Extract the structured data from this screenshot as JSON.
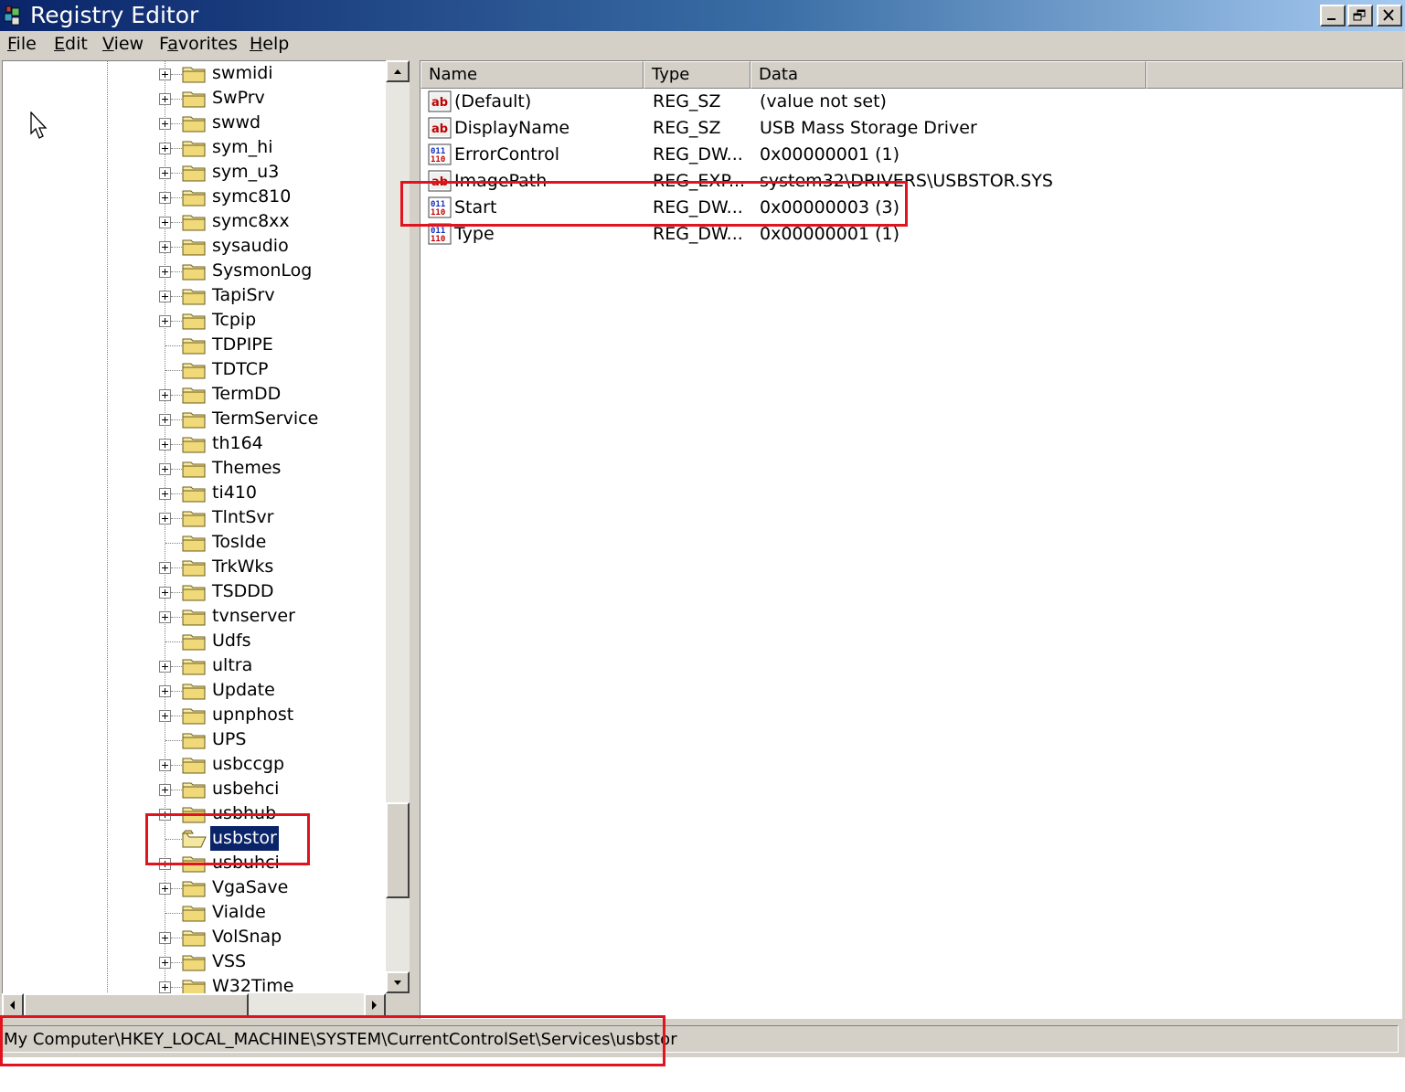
{
  "window": {
    "title": "Registry Editor"
  },
  "menu": [
    {
      "pre": "",
      "key": "F",
      "post": "ile"
    },
    {
      "pre": "",
      "key": "E",
      "post": "dit"
    },
    {
      "pre": "",
      "key": "V",
      "post": "iew"
    },
    {
      "pre": "F",
      "key": "a",
      "post": "vorites"
    },
    {
      "pre": "",
      "key": "H",
      "post": "elp"
    }
  ],
  "tree": {
    "items": [
      {
        "label": "swmidi",
        "expandable": true
      },
      {
        "label": "SwPrv",
        "expandable": true
      },
      {
        "label": "swwd",
        "expandable": true
      },
      {
        "label": "sym_hi",
        "expandable": true
      },
      {
        "label": "sym_u3",
        "expandable": true
      },
      {
        "label": "symc810",
        "expandable": true
      },
      {
        "label": "symc8xx",
        "expandable": true
      },
      {
        "label": "sysaudio",
        "expandable": true
      },
      {
        "label": "SysmonLog",
        "expandable": true
      },
      {
        "label": "TapiSrv",
        "expandable": true
      },
      {
        "label": "Tcpip",
        "expandable": true
      },
      {
        "label": "TDPIPE",
        "expandable": false
      },
      {
        "label": "TDTCP",
        "expandable": false
      },
      {
        "label": "TermDD",
        "expandable": true
      },
      {
        "label": "TermService",
        "expandable": true
      },
      {
        "label": "th164",
        "expandable": true
      },
      {
        "label": "Themes",
        "expandable": true
      },
      {
        "label": "ti410",
        "expandable": true
      },
      {
        "label": "TlntSvr",
        "expandable": true
      },
      {
        "label": "TosIde",
        "expandable": false
      },
      {
        "label": "TrkWks",
        "expandable": true
      },
      {
        "label": "TSDDD",
        "expandable": true
      },
      {
        "label": "tvnserver",
        "expandable": true
      },
      {
        "label": "Udfs",
        "expandable": false
      },
      {
        "label": "ultra",
        "expandable": true
      },
      {
        "label": "Update",
        "expandable": true
      },
      {
        "label": "upnphost",
        "expandable": true
      },
      {
        "label": "UPS",
        "expandable": false
      },
      {
        "label": "usbccgp",
        "expandable": true
      },
      {
        "label": "usbehci",
        "expandable": true
      },
      {
        "label": "usbhub",
        "expandable": true
      },
      {
        "label": "usbstor",
        "expandable": false,
        "selected": true
      },
      {
        "label": "usbuhci",
        "expandable": true
      },
      {
        "label": "VgaSave",
        "expandable": true
      },
      {
        "label": "ViaIde",
        "expandable": false
      },
      {
        "label": "VolSnap",
        "expandable": true
      },
      {
        "label": "VSS",
        "expandable": true
      },
      {
        "label": "W32Time",
        "expandable": true
      }
    ]
  },
  "list": {
    "columns": [
      "Name",
      "Type",
      "Data"
    ],
    "rows": [
      {
        "icon": "string-value-icon",
        "name": "(Default)",
        "type": "REG_SZ",
        "data": "(value not set)"
      },
      {
        "icon": "string-value-icon",
        "name": "DisplayName",
        "type": "REG_SZ",
        "data": "USB Mass Storage Driver"
      },
      {
        "icon": "dword-value-icon",
        "name": "ErrorControl",
        "type": "REG_DW...",
        "data": "0x00000001 (1)"
      },
      {
        "icon": "string-value-icon",
        "name": "ImagePath",
        "type": "REG_EXP...",
        "data": "system32\\DRIVERS\\USBSTOR.SYS"
      },
      {
        "icon": "dword-value-icon",
        "name": "Start",
        "type": "REG_DW...",
        "data": "0x00000003 (3)"
      },
      {
        "icon": "dword-value-icon",
        "name": "Type",
        "type": "REG_DW...",
        "data": "0x00000001 (1)"
      }
    ]
  },
  "status": {
    "path": "My Computer\\HKEY_LOCAL_MACHINE\\SYSTEM\\CurrentControlSet\\Services\\usbstor"
  },
  "colors": {
    "annotation": "#e0141e",
    "selection": "#0a246a",
    "chrome": "#d4d0c8"
  }
}
